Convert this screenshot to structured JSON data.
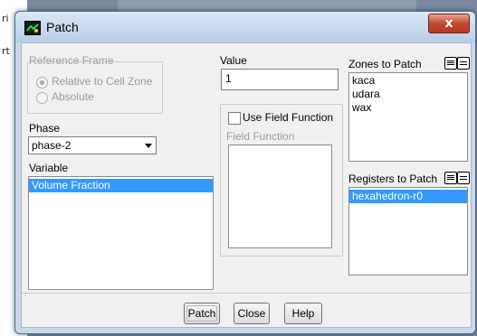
{
  "background": {
    "fragments": [
      "ri",
      "rt"
    ]
  },
  "dialog": {
    "title": "Patch",
    "close_glyph": "x"
  },
  "reference_frame": {
    "label": "Reference Frame",
    "options": [
      "Relative to Cell Zone",
      "Absolute"
    ],
    "selected": "Relative to Cell Zone"
  },
  "phase": {
    "label": "Phase",
    "selected": "phase-2"
  },
  "variable": {
    "label": "Variable",
    "items": [
      "Volume Fraction"
    ],
    "selected": "Volume Fraction"
  },
  "value": {
    "label": "Value",
    "current": "1"
  },
  "field_function": {
    "checkbox_label": "Use Field Function",
    "checked": false,
    "list_label": "Field Function",
    "items": []
  },
  "zones_to_patch": {
    "label": "Zones to Patch",
    "items": [
      "kaca",
      "udara",
      "wax"
    ]
  },
  "registers_to_patch": {
    "label": "Registers to Patch",
    "items": [
      "hexahedron-r0"
    ],
    "selected": "hexahedron-r0"
  },
  "buttons": {
    "patch": "Patch",
    "close": "Close",
    "help": "Help"
  },
  "icons": {
    "select_all": "select-all-icon",
    "deselect_all": "deselect-all-icon",
    "app": "fluent-app-icon"
  },
  "colors": {
    "title_bar": "#c9d8ea",
    "close_button": "#c24a32",
    "selection": "#3399ff"
  }
}
